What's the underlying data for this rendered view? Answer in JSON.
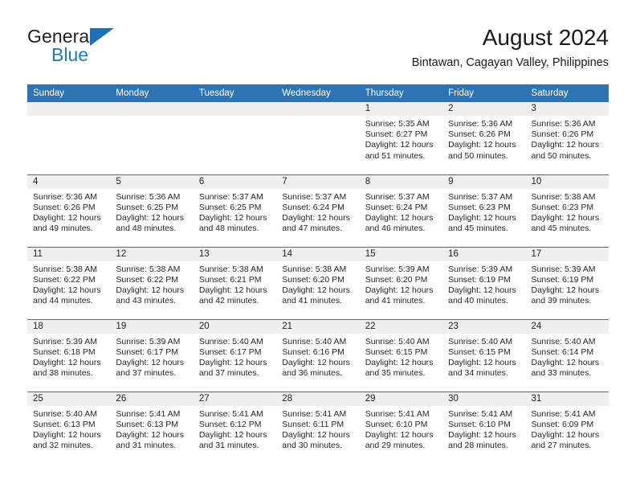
{
  "brand": {
    "line1": "General",
    "line2": "Blue",
    "accent_color": "#1f7ac4",
    "triangle_color": "#1f6fb6"
  },
  "header": {
    "title": "August 2024",
    "subtitle": "Bintawan, Cagayan Valley, Philippines"
  },
  "theme": {
    "header_blue": "#2e74b5",
    "daynum_band": "#efefef",
    "text": "#262626"
  },
  "weekday_headers": [
    "Sunday",
    "Monday",
    "Tuesday",
    "Wednesday",
    "Thursday",
    "Friday",
    "Saturday"
  ],
  "labels": {
    "sunrise_prefix": "Sunrise:",
    "sunset_prefix": "Sunset:",
    "daylight_prefix": "Daylight:"
  },
  "weeks": [
    [
      {
        "day": "",
        "blank": true
      },
      {
        "day": "",
        "blank": true
      },
      {
        "day": "",
        "blank": true
      },
      {
        "day": "",
        "blank": true
      },
      {
        "day": "1",
        "sunrise": "Sunrise: 5:35 AM",
        "sunset": "Sunset: 6:27 PM",
        "daylight_1": "Daylight: 12 hours",
        "daylight_2": "and 51 minutes."
      },
      {
        "day": "2",
        "sunrise": "Sunrise: 5:36 AM",
        "sunset": "Sunset: 6:26 PM",
        "daylight_1": "Daylight: 12 hours",
        "daylight_2": "and 50 minutes."
      },
      {
        "day": "3",
        "sunrise": "Sunrise: 5:36 AM",
        "sunset": "Sunset: 6:26 PM",
        "daylight_1": "Daylight: 12 hours",
        "daylight_2": "and 50 minutes."
      }
    ],
    [
      {
        "day": "4",
        "sunrise": "Sunrise: 5:36 AM",
        "sunset": "Sunset: 6:26 PM",
        "daylight_1": "Daylight: 12 hours",
        "daylight_2": "and 49 minutes."
      },
      {
        "day": "5",
        "sunrise": "Sunrise: 5:36 AM",
        "sunset": "Sunset: 6:25 PM",
        "daylight_1": "Daylight: 12 hours",
        "daylight_2": "and 48 minutes."
      },
      {
        "day": "6",
        "sunrise": "Sunrise: 5:37 AM",
        "sunset": "Sunset: 6:25 PM",
        "daylight_1": "Daylight: 12 hours",
        "daylight_2": "and 48 minutes."
      },
      {
        "day": "7",
        "sunrise": "Sunrise: 5:37 AM",
        "sunset": "Sunset: 6:24 PM",
        "daylight_1": "Daylight: 12 hours",
        "daylight_2": "and 47 minutes."
      },
      {
        "day": "8",
        "sunrise": "Sunrise: 5:37 AM",
        "sunset": "Sunset: 6:24 PM",
        "daylight_1": "Daylight: 12 hours",
        "daylight_2": "and 46 minutes."
      },
      {
        "day": "9",
        "sunrise": "Sunrise: 5:37 AM",
        "sunset": "Sunset: 6:23 PM",
        "daylight_1": "Daylight: 12 hours",
        "daylight_2": "and 45 minutes."
      },
      {
        "day": "10",
        "sunrise": "Sunrise: 5:38 AM",
        "sunset": "Sunset: 6:23 PM",
        "daylight_1": "Daylight: 12 hours",
        "daylight_2": "and 45 minutes."
      }
    ],
    [
      {
        "day": "11",
        "sunrise": "Sunrise: 5:38 AM",
        "sunset": "Sunset: 6:22 PM",
        "daylight_1": "Daylight: 12 hours",
        "daylight_2": "and 44 minutes."
      },
      {
        "day": "12",
        "sunrise": "Sunrise: 5:38 AM",
        "sunset": "Sunset: 6:22 PM",
        "daylight_1": "Daylight: 12 hours",
        "daylight_2": "and 43 minutes."
      },
      {
        "day": "13",
        "sunrise": "Sunrise: 5:38 AM",
        "sunset": "Sunset: 6:21 PM",
        "daylight_1": "Daylight: 12 hours",
        "daylight_2": "and 42 minutes."
      },
      {
        "day": "14",
        "sunrise": "Sunrise: 5:38 AM",
        "sunset": "Sunset: 6:20 PM",
        "daylight_1": "Daylight: 12 hours",
        "daylight_2": "and 41 minutes."
      },
      {
        "day": "15",
        "sunrise": "Sunrise: 5:39 AM",
        "sunset": "Sunset: 6:20 PM",
        "daylight_1": "Daylight: 12 hours",
        "daylight_2": "and 41 minutes."
      },
      {
        "day": "16",
        "sunrise": "Sunrise: 5:39 AM",
        "sunset": "Sunset: 6:19 PM",
        "daylight_1": "Daylight: 12 hours",
        "daylight_2": "and 40 minutes."
      },
      {
        "day": "17",
        "sunrise": "Sunrise: 5:39 AM",
        "sunset": "Sunset: 6:19 PM",
        "daylight_1": "Daylight: 12 hours",
        "daylight_2": "and 39 minutes."
      }
    ],
    [
      {
        "day": "18",
        "sunrise": "Sunrise: 5:39 AM",
        "sunset": "Sunset: 6:18 PM",
        "daylight_1": "Daylight: 12 hours",
        "daylight_2": "and 38 minutes."
      },
      {
        "day": "19",
        "sunrise": "Sunrise: 5:39 AM",
        "sunset": "Sunset: 6:17 PM",
        "daylight_1": "Daylight: 12 hours",
        "daylight_2": "and 37 minutes."
      },
      {
        "day": "20",
        "sunrise": "Sunrise: 5:40 AM",
        "sunset": "Sunset: 6:17 PM",
        "daylight_1": "Daylight: 12 hours",
        "daylight_2": "and 37 minutes."
      },
      {
        "day": "21",
        "sunrise": "Sunrise: 5:40 AM",
        "sunset": "Sunset: 6:16 PM",
        "daylight_1": "Daylight: 12 hours",
        "daylight_2": "and 36 minutes."
      },
      {
        "day": "22",
        "sunrise": "Sunrise: 5:40 AM",
        "sunset": "Sunset: 6:15 PM",
        "daylight_1": "Daylight: 12 hours",
        "daylight_2": "and 35 minutes."
      },
      {
        "day": "23",
        "sunrise": "Sunrise: 5:40 AM",
        "sunset": "Sunset: 6:15 PM",
        "daylight_1": "Daylight: 12 hours",
        "daylight_2": "and 34 minutes."
      },
      {
        "day": "24",
        "sunrise": "Sunrise: 5:40 AM",
        "sunset": "Sunset: 6:14 PM",
        "daylight_1": "Daylight: 12 hours",
        "daylight_2": "and 33 minutes."
      }
    ],
    [
      {
        "day": "25",
        "sunrise": "Sunrise: 5:40 AM",
        "sunset": "Sunset: 6:13 PM",
        "daylight_1": "Daylight: 12 hours",
        "daylight_2": "and 32 minutes."
      },
      {
        "day": "26",
        "sunrise": "Sunrise: 5:41 AM",
        "sunset": "Sunset: 6:13 PM",
        "daylight_1": "Daylight: 12 hours",
        "daylight_2": "and 31 minutes."
      },
      {
        "day": "27",
        "sunrise": "Sunrise: 5:41 AM",
        "sunset": "Sunset: 6:12 PM",
        "daylight_1": "Daylight: 12 hours",
        "daylight_2": "and 31 minutes."
      },
      {
        "day": "28",
        "sunrise": "Sunrise: 5:41 AM",
        "sunset": "Sunset: 6:11 PM",
        "daylight_1": "Daylight: 12 hours",
        "daylight_2": "and 30 minutes."
      },
      {
        "day": "29",
        "sunrise": "Sunrise: 5:41 AM",
        "sunset": "Sunset: 6:10 PM",
        "daylight_1": "Daylight: 12 hours",
        "daylight_2": "and 29 minutes."
      },
      {
        "day": "30",
        "sunrise": "Sunrise: 5:41 AM",
        "sunset": "Sunset: 6:10 PM",
        "daylight_1": "Daylight: 12 hours",
        "daylight_2": "and 28 minutes."
      },
      {
        "day": "31",
        "sunrise": "Sunrise: 5:41 AM",
        "sunset": "Sunset: 6:09 PM",
        "daylight_1": "Daylight: 12 hours",
        "daylight_2": "and 27 minutes."
      }
    ]
  ]
}
